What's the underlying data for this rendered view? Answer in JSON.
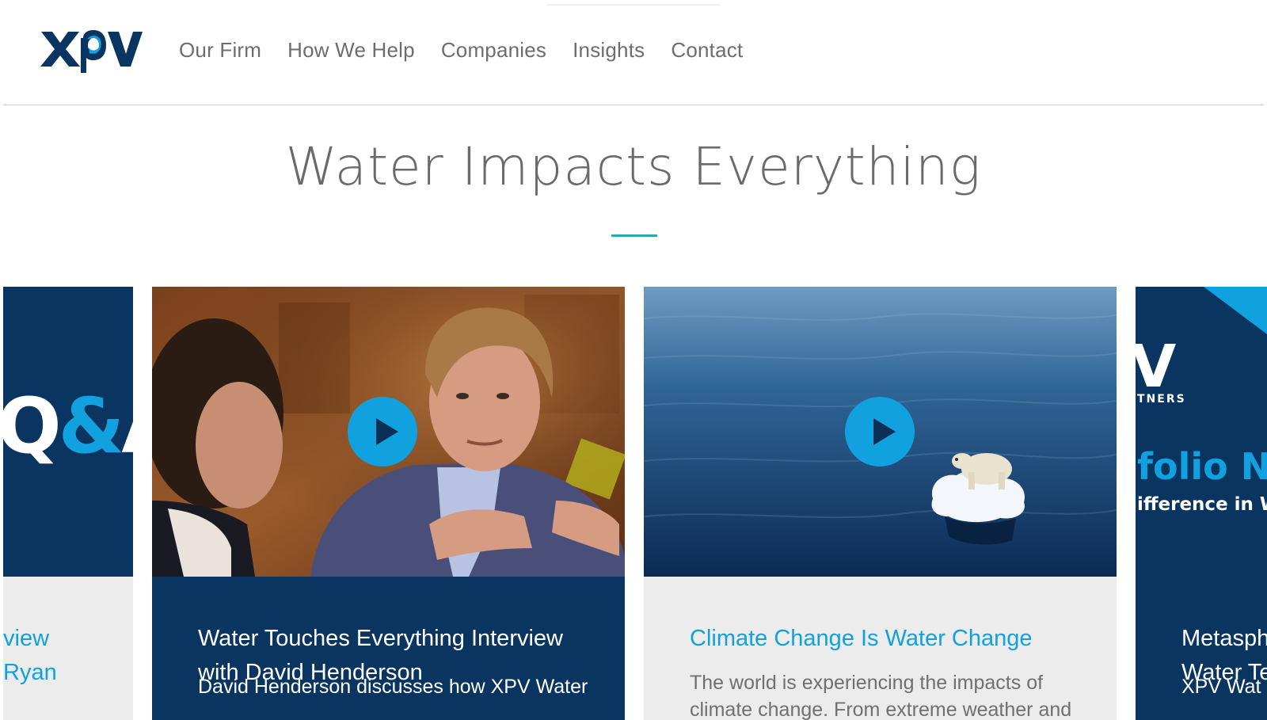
{
  "header": {
    "logo_alt": "XPV",
    "nav": [
      {
        "label": "Our Firm"
      },
      {
        "label": "How We Help"
      },
      {
        "label": "Companies"
      },
      {
        "label": "Insights"
      },
      {
        "label": "Contact"
      }
    ]
  },
  "hero": {
    "title": "Water Impacts Everything"
  },
  "colors": {
    "brand_navy": "#0a3561",
    "brand_blue": "#10a1de",
    "accent_teal": "#2aa8b3",
    "text_gray": "#6a6a6a"
  },
  "cards": [
    {
      "media_text_part1": "Q",
      "media_text_amp": "&",
      "media_text_part2": "A",
      "title": "view\nRyan",
      "title_line1": "view",
      "title_line2": "Ryan"
    },
    {
      "title_line1": "Water Touches Everything Interview",
      "title_line2": "with David Henderson",
      "excerpt": "David Henderson discusses how XPV Water",
      "media_icon": "play-icon"
    },
    {
      "title": "Climate Change Is Water Change",
      "excerpt_line1": "The world is experiencing the impacts of",
      "excerpt_line2": "climate change. From extreme weather and",
      "media_icon": "play-icon"
    },
    {
      "media_logo": "V",
      "media_partners": "TNERS",
      "media_headline": "folio Ne",
      "media_sub": "ifference in W",
      "title_line1": "Metasph",
      "title_line2": "Water Te",
      "excerpt": "XPV Wat"
    }
  ]
}
